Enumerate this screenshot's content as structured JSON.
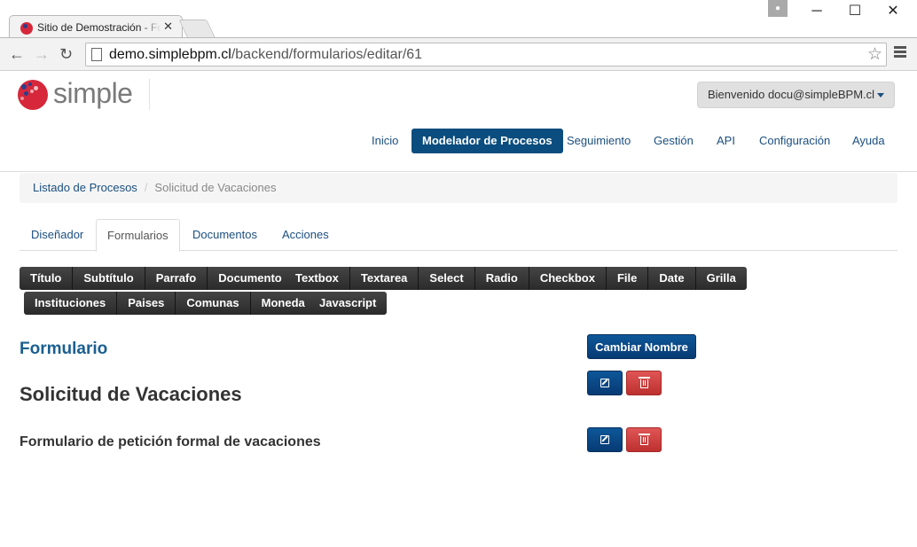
{
  "browser": {
    "tab_title": "Sitio de Demostración - Formularios",
    "url_host": "demo.simplebpm.cl",
    "url_path": "/backend/formularios/editar/61"
  },
  "header": {
    "logo_text": "simple",
    "welcome": "Bienvenido docu@simpleBPM.cl"
  },
  "nav": {
    "items": [
      "Inicio",
      "Modelador de Procesos",
      "Seguimiento",
      "Gestión",
      "API",
      "Configuración",
      "Ayuda"
    ],
    "active": "Modelador de Procesos"
  },
  "breadcrumb": {
    "link": "Listado de Procesos",
    "separator": "/",
    "current": "Solicitud de Vacaciones"
  },
  "tabs": {
    "items": [
      "Diseñador",
      "Formularios",
      "Documentos",
      "Acciones"
    ],
    "active": "Formularios"
  },
  "components": {
    "group1": [
      "Título",
      "Subtítulo",
      "Parrafo",
      "Documento"
    ],
    "group2": [
      "Textbox",
      "Textarea",
      "Select",
      "Radio",
      "Checkbox",
      "File",
      "Date",
      "Grilla"
    ],
    "group3": [
      "Instituciones",
      "Paises",
      "Comunas",
      "Moneda"
    ],
    "group4": [
      "Javascript"
    ]
  },
  "form": {
    "heading": "Formulario",
    "rename_button": "Cambiar Nombre",
    "title": "Solicitud de Vacaciones",
    "subtitle": "Formulario de petición formal de vacaciones"
  },
  "colors": {
    "primary": "#0a4d7e",
    "danger": "#d24444",
    "link": "#1b4f7f"
  }
}
